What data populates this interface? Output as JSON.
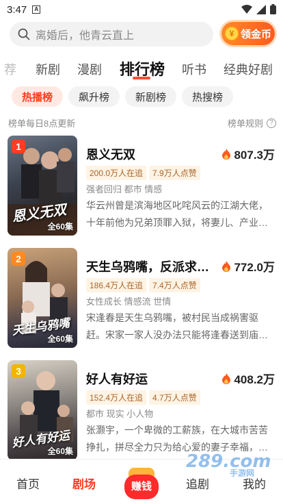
{
  "status": {
    "time": "3:47",
    "sim_label": "A"
  },
  "search": {
    "placeholder": "离婚后，他青云直上",
    "coin_label": "领金币",
    "coin_symbol": "¥"
  },
  "categories": [
    "荐",
    "新剧",
    "漫剧",
    "排行榜",
    "听书",
    "经典好剧"
  ],
  "sub_tabs": [
    "热播榜",
    "飙升榜",
    "新剧榜",
    "热搜榜"
  ],
  "info": {
    "update_note": "榜单每日8点更新",
    "rules_label": "榜单规则",
    "rules_icon": "?"
  },
  "items": [
    {
      "rank": "1",
      "rank_color": "#ff3d1f",
      "title": "恩义无双",
      "heat": "807.3万",
      "badge_follow": "200.0万人在追",
      "badge_like": "7.9万人点赞",
      "tags": "强者回归 都市 情感",
      "desc": "华云州曾是滨海地区叱咤风云的江湖大佬，十年前他为兄弟顶罪入狱，将妻儿、产业…",
      "episodes": "全60集",
      "cover_text": "恩义无双"
    },
    {
      "rank": "2",
      "rank_color": "#ff8a1f",
      "title": "天生乌鸦嘴，反派求我别…",
      "heat": "772.0万",
      "badge_follow": "186.4万人在追",
      "badge_like": "7.4万人点赞",
      "tags": "女性成长 情感流 世情",
      "desc": "宋逢春是天生乌鸦嘴，被村民当成祸害驱赶。宋家一家人没办法只能将逢春送到庙…",
      "episodes": "全60集",
      "cover_text": "天生乌鸦嘴"
    },
    {
      "rank": "3",
      "rank_color": "#f5b400",
      "title": "好人有好运",
      "heat": "408.2万",
      "badge_follow": "152.4万人在追",
      "badge_like": "4.7万人点赞",
      "tags": "都市 现实 小人物",
      "desc": "张灏宇，一个卑微的工薪族，在大城市苦苦挣扎，拼尽全力只为给心爱的妻子幸福，…",
      "episodes": "全60集",
      "cover_text": "好人有好运"
    }
  ],
  "nav": {
    "home": "首页",
    "theater": "剧场",
    "earn": "赚钱",
    "follow": "追剧",
    "mine": "我的"
  },
  "watermark": {
    "text": "289.com",
    "sub": "手游网"
  }
}
